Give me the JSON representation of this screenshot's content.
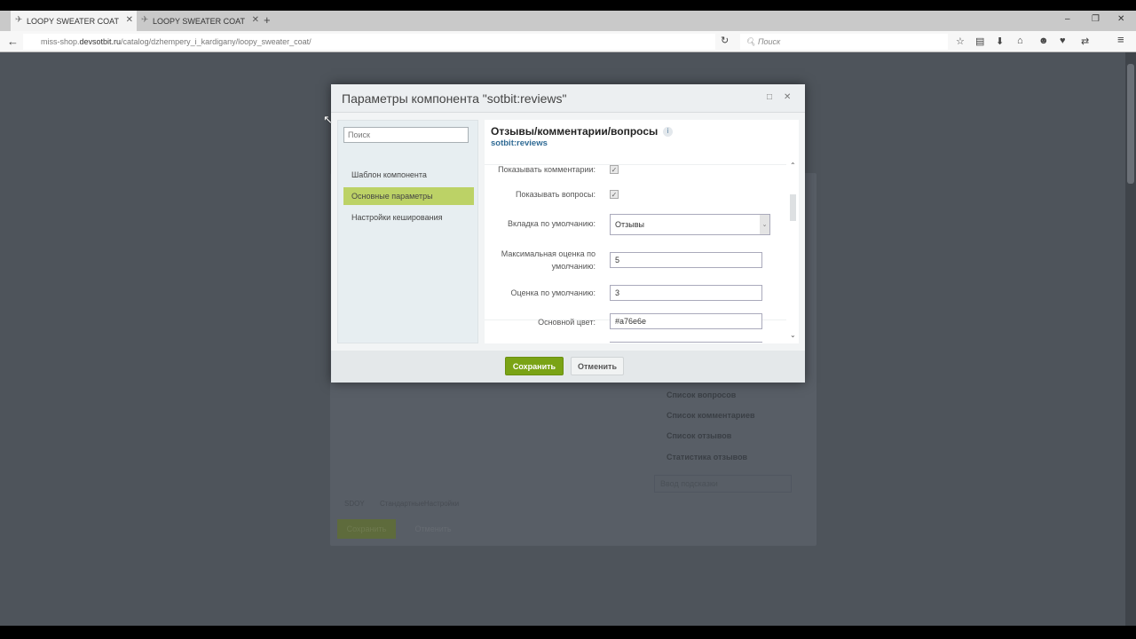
{
  "browser": {
    "tabs": [
      {
        "title": "LOOPY SWEATER COAT"
      },
      {
        "title": "LOOPY SWEATER COAT"
      }
    ],
    "new_tab": "+",
    "url_prefix": "miss-shop.",
    "url_domain": "devsotbit.ru",
    "url_path": "/catalog/dzhempery_i_kardigany/loopy_sweater_coat/",
    "search_placeholder": "Поиск"
  },
  "background_dialog": {
    "items": [
      "Список вопросов",
      "Список комментариев",
      "Список отзывов",
      "Статистика отзывов"
    ],
    "search_placeholder": "Ввод подсказки",
    "footer_left": "SDOY",
    "footer_text": "СтандартныеНастройки",
    "save": "Сохранить",
    "cancel": "Отменить"
  },
  "dialog": {
    "title": "Параметры компонента \"sotbit:reviews\"",
    "sidebar": {
      "search_placeholder": "Поиск",
      "items": [
        "Шаблон компонента",
        "Основные параметры",
        "Настройки кеширования"
      ]
    },
    "heading": "Отзывы/комментарии/вопросы",
    "component_id": "sotbit:reviews",
    "info": "i",
    "fields": {
      "show_comments": {
        "label": "Показывать комментарии:",
        "checked": true
      },
      "show_questions": {
        "label": "Показывать вопросы:",
        "checked": true
      },
      "default_tab": {
        "label": "Вкладка по умолчанию:",
        "value": "Отзывы"
      },
      "max_rating": {
        "label1": "Максимальная оценка по",
        "label2": "умолчанию:",
        "value": "5"
      },
      "default_rating": {
        "label": "Оценка по умолчанию:",
        "value": "3"
      },
      "main_color": {
        "label": "Основной цвет:",
        "value": "#a76e6e"
      }
    },
    "save": "Сохранить",
    "cancel": "Отменить"
  },
  "colors": {
    "accent": "#bcd266",
    "save": "#7aa315"
  }
}
